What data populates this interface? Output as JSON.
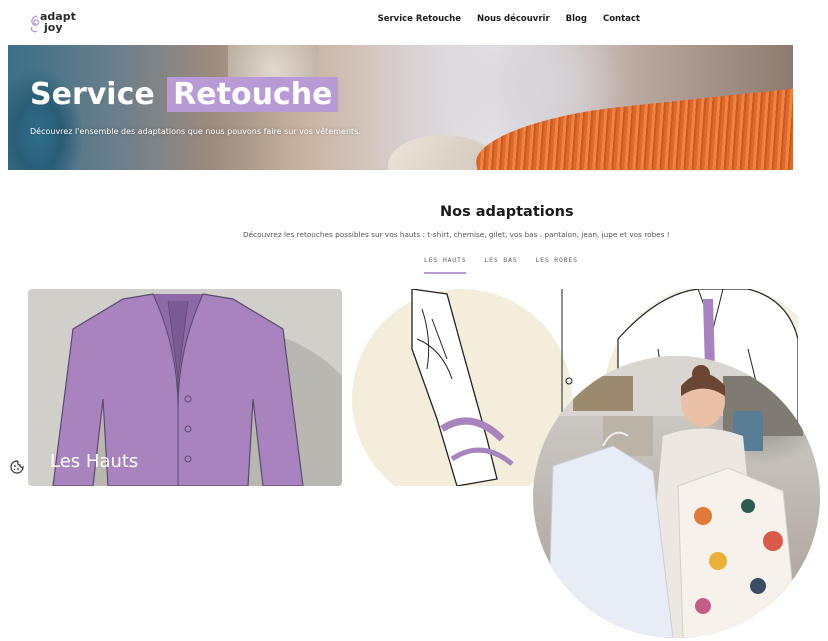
{
  "brand": {
    "line1": "adapt",
    "line2": "joy",
    "accent": "#b89ad4"
  },
  "nav": {
    "items": [
      {
        "label": "Service Retouche"
      },
      {
        "label": "Nous découvrir"
      },
      {
        "label": "Blog"
      },
      {
        "label": "Contact"
      }
    ]
  },
  "hero": {
    "title_part1": "Service",
    "title_highlight": "Retouche",
    "subtitle": "Découvrez l'ensemble des adaptations que nous pouvons faire sur vos vêtements."
  },
  "section": {
    "title": "Nos adaptations",
    "subtitle": "Découvrez les retouches possibles sur vos hauts : t-shirt, chemise, gilet, vos bas : pantalon, jean, jupe et vos robes !",
    "tabs": [
      {
        "label": "LES HAUTS",
        "active": true
      },
      {
        "label": "LES BAS",
        "active": false
      },
      {
        "label": "LES ROBES",
        "active": false
      }
    ]
  },
  "cards": [
    {
      "tag": "",
      "title": "Les Hauts"
    }
  ],
  "icons": {
    "cookie": "cookie-icon",
    "logo": "swirl-logo-icon"
  }
}
